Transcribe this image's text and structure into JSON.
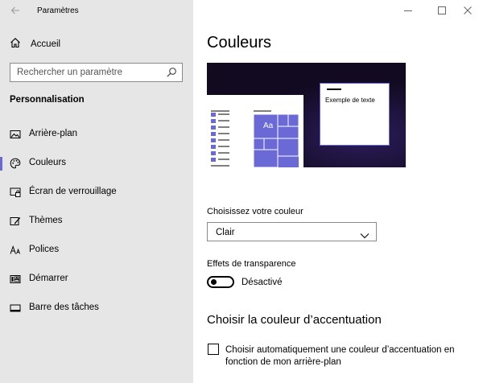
{
  "window": {
    "title": "Paramètres"
  },
  "sidebar": {
    "home_label": "Accueil",
    "search_placeholder": "Rechercher un paramètre",
    "section_title": "Personnalisation",
    "items": [
      {
        "label": "Arrière-plan",
        "icon": "image-icon",
        "selected": false
      },
      {
        "label": "Couleurs",
        "icon": "palette-icon",
        "selected": true
      },
      {
        "label": "Écran de verrouillage",
        "icon": "lock-screen-icon",
        "selected": false
      },
      {
        "label": "Thèmes",
        "icon": "themes-icon",
        "selected": false
      },
      {
        "label": "Polices",
        "icon": "fonts-icon",
        "selected": false
      },
      {
        "label": "Démarrer",
        "icon": "start-icon",
        "selected": false
      },
      {
        "label": "Barre des tâches",
        "icon": "taskbar-icon",
        "selected": false
      }
    ]
  },
  "main": {
    "title": "Couleurs",
    "preview": {
      "tile_text": "Aa",
      "sample_text": "Exemple de texte"
    },
    "color_label": "Choisissez votre couleur",
    "color_value": "Clair",
    "transparency_label": "Effets de transparence",
    "transparency_state": "Désactivé",
    "accent_title": "Choisir la couleur d’accentuation",
    "auto_accent_label": "Choisir automatiquement une couleur d’accentuation en fonction de mon arrière-plan"
  },
  "colors": {
    "accent": "#6b69d6",
    "sidebar_bg": "#e6e6e6"
  }
}
